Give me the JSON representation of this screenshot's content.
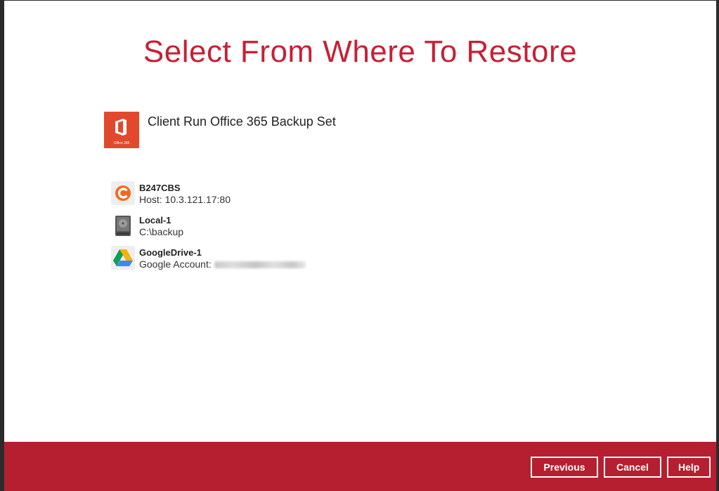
{
  "page": {
    "title": "Select From Where To Restore"
  },
  "backup_set": {
    "icon": "office-365-icon",
    "logo_text": "Office 365",
    "name": "Client Run Office 365 Backup Set"
  },
  "destinations": [
    {
      "icon": "cbs-icon",
      "name": "B247CBS",
      "detail": "Host: 10.3.121.17:80"
    },
    {
      "icon": "local-drive-icon",
      "name": "Local-1",
      "detail": "C:\\backup"
    },
    {
      "icon": "google-drive-icon",
      "name": "GoogleDrive-1",
      "detail": "Google Account:"
    }
  ],
  "footer": {
    "previous_label": "Previous",
    "cancel_label": "Cancel",
    "help_label": "Help"
  },
  "colors": {
    "accent": "#c62035",
    "footer_bg": "#b61f2f",
    "office_orange": "#e2492c",
    "cbs_orange": "#f26b1d"
  }
}
